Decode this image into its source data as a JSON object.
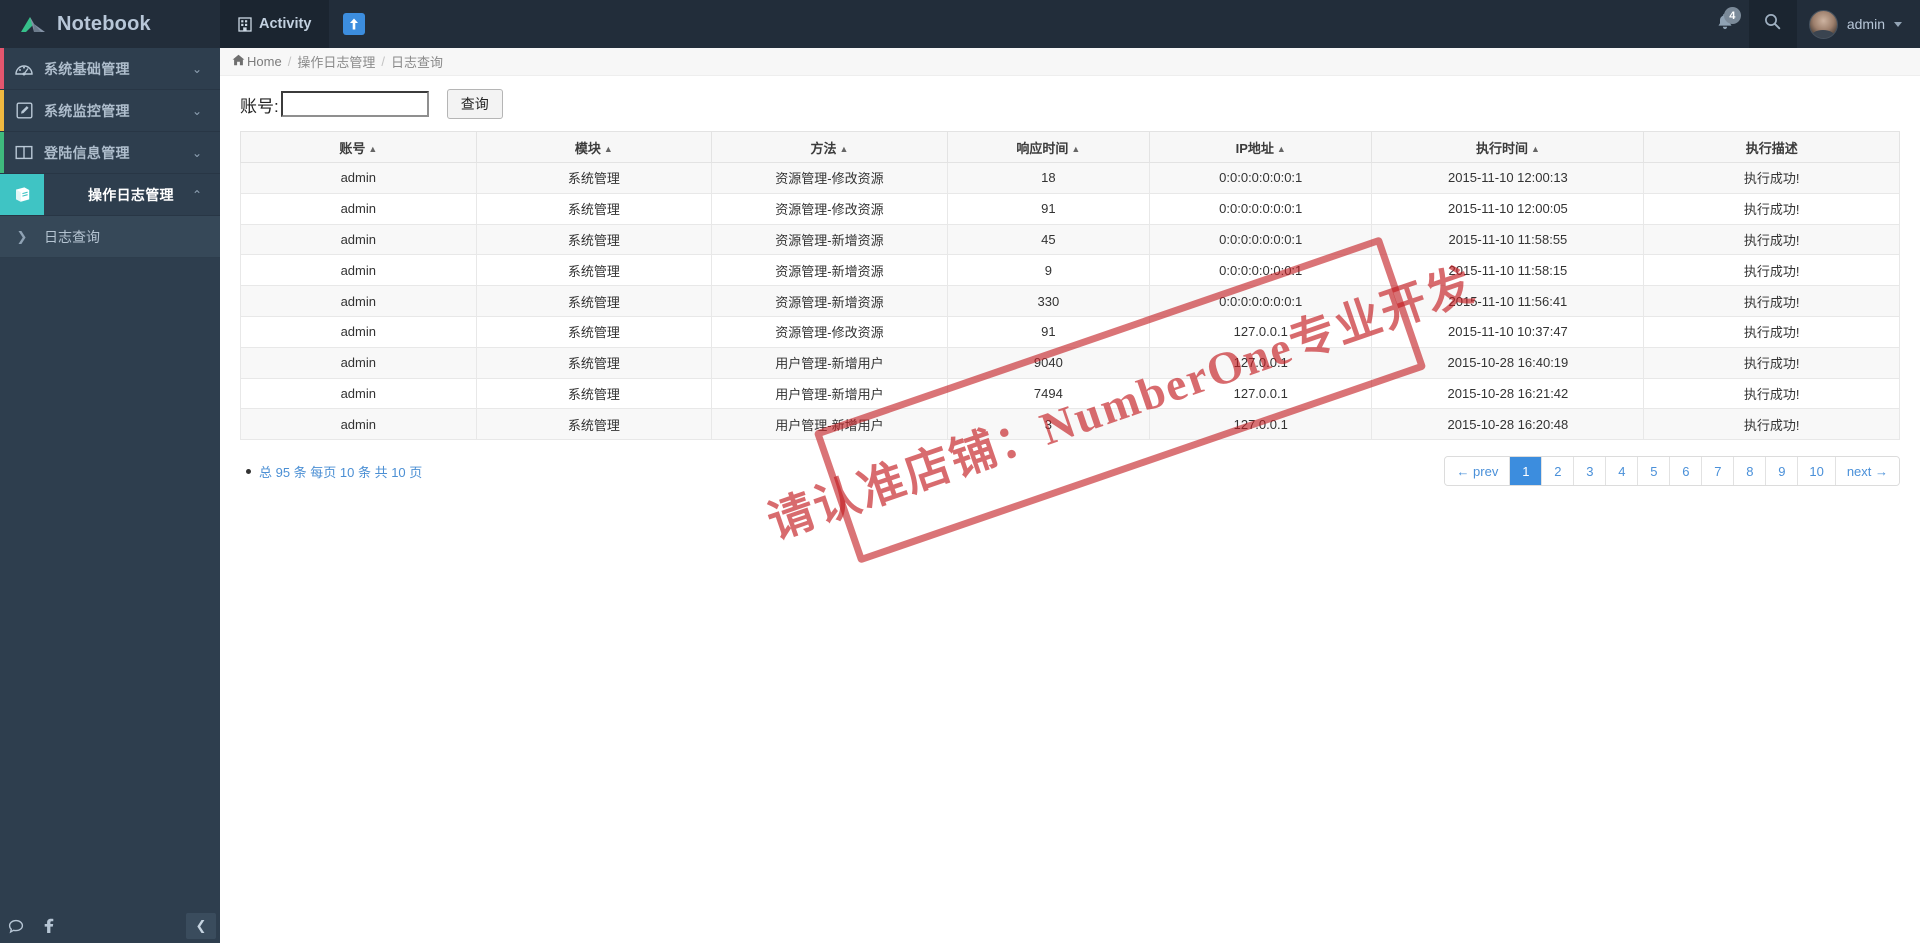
{
  "brand": {
    "name": "Notebook",
    "logo_icon": "notebook-logo-icon"
  },
  "topbar": {
    "tabs": [
      {
        "label": "Activity",
        "icon": "building-icon",
        "active": true
      },
      {
        "label": "",
        "icon": "arrow-up-icon",
        "active": false
      }
    ],
    "notifications": {
      "icon": "bell-icon",
      "count": "4"
    },
    "search_icon": "search-icon",
    "user": {
      "name": "admin",
      "avatar_icon": "avatar",
      "caret_icon": "chevron-down-icon"
    }
  },
  "sidebar": {
    "items": [
      {
        "label": "系统基础管理",
        "icon": "dashboard-icon",
        "accent": "#e4566e",
        "chevron": "chevron-down-icon",
        "active": false
      },
      {
        "label": "系统监控管理",
        "icon": "pencil-square-icon",
        "accent": "#f0b840",
        "chevron": "chevron-down-icon",
        "active": false
      },
      {
        "label": "登陆信息管理",
        "icon": "columns-icon",
        "accent": "#3fba7d",
        "chevron": "chevron-down-icon",
        "active": false
      },
      {
        "label": "操作日志管理",
        "icon": "book-icon",
        "accent": "#3fc4c4",
        "chevron": "chevron-up-icon",
        "active": true
      }
    ],
    "sub_items": [
      {
        "label": "日志查询",
        "icon": "chevron-right-icon",
        "active": true
      }
    ],
    "footer": {
      "chat_icon": "chat-bubble-icon",
      "facebook_icon": "facebook-icon",
      "collapse_icon": "chevron-left-icon"
    }
  },
  "breadcrumb": {
    "home_icon": "home-icon",
    "home_label": "Home",
    "separator": "/",
    "crumbs": [
      "操作日志管理",
      "日志查询"
    ]
  },
  "search_form": {
    "label": "账号:",
    "value": "",
    "placeholder": "",
    "button_label": "查询"
  },
  "table": {
    "columns": [
      {
        "label": "账号",
        "sortable": true,
        "arrow": "▲"
      },
      {
        "label": "模块",
        "sortable": true,
        "arrow": "▲"
      },
      {
        "label": "方法",
        "sortable": true,
        "arrow": "▲"
      },
      {
        "label": "响应时间",
        "sortable": true,
        "arrow": "▲"
      },
      {
        "label": "IP地址",
        "sortable": true,
        "arrow": "▲"
      },
      {
        "label": "执行时间",
        "sortable": true,
        "arrow": "▲"
      },
      {
        "label": "执行描述",
        "sortable": false,
        "arrow": ""
      }
    ],
    "rows": [
      [
        "admin",
        "系统管理",
        "资源管理-修改资源",
        "18",
        "0:0:0:0:0:0:0:1",
        "2015-11-10 12:00:13",
        "执行成功!"
      ],
      [
        "admin",
        "系统管理",
        "资源管理-修改资源",
        "91",
        "0:0:0:0:0:0:0:1",
        "2015-11-10 12:00:05",
        "执行成功!"
      ],
      [
        "admin",
        "系统管理",
        "资源管理-新增资源",
        "45",
        "0:0:0:0:0:0:0:1",
        "2015-11-10 11:58:55",
        "执行成功!"
      ],
      [
        "admin",
        "系统管理",
        "资源管理-新增资源",
        "9",
        "0:0:0:0:0:0:0:1",
        "2015-11-10 11:58:15",
        "执行成功!"
      ],
      [
        "admin",
        "系统管理",
        "资源管理-新增资源",
        "330",
        "0:0:0:0:0:0:0:1",
        "2015-11-10 11:56:41",
        "执行成功!"
      ],
      [
        "admin",
        "系统管理",
        "资源管理-修改资源",
        "91",
        "127.0.0.1",
        "2015-11-10 10:37:47",
        "执行成功!"
      ],
      [
        "admin",
        "系统管理",
        "用户管理-新增用户",
        "9040",
        "127.0.0.1",
        "2015-10-28 16:40:19",
        "执行成功!"
      ],
      [
        "admin",
        "系统管理",
        "用户管理-新增用户",
        "7494",
        "127.0.0.1",
        "2015-10-28 16:21:42",
        "执行成功!"
      ],
      [
        "admin",
        "系统管理",
        "用户管理-新增用户",
        "3",
        "127.0.0.1",
        "2015-10-28 16:20:48",
        "执行成功!"
      ]
    ]
  },
  "footer_info": {
    "total_label": "总 95 条 每页 10 条 共 10 页",
    "total_records": "95",
    "per_page": "10",
    "total_pages": "10"
  },
  "pagination": {
    "prev_label": "← prev",
    "next_label": "next →",
    "pages": [
      "1",
      "2",
      "3",
      "4",
      "5",
      "6",
      "7",
      "8",
      "9",
      "10"
    ],
    "active_page": "1",
    "active_color": "#3c8dde"
  },
  "watermark": {
    "text": "请认准店铺：NumberOne专业开发",
    "color": "#c41e23"
  },
  "colors": {
    "topbar_bg": "#222d3a",
    "sidebar_bg": "#2e3e4e",
    "active_teal": "#3fc4c4",
    "link_blue": "#4a90d9"
  }
}
